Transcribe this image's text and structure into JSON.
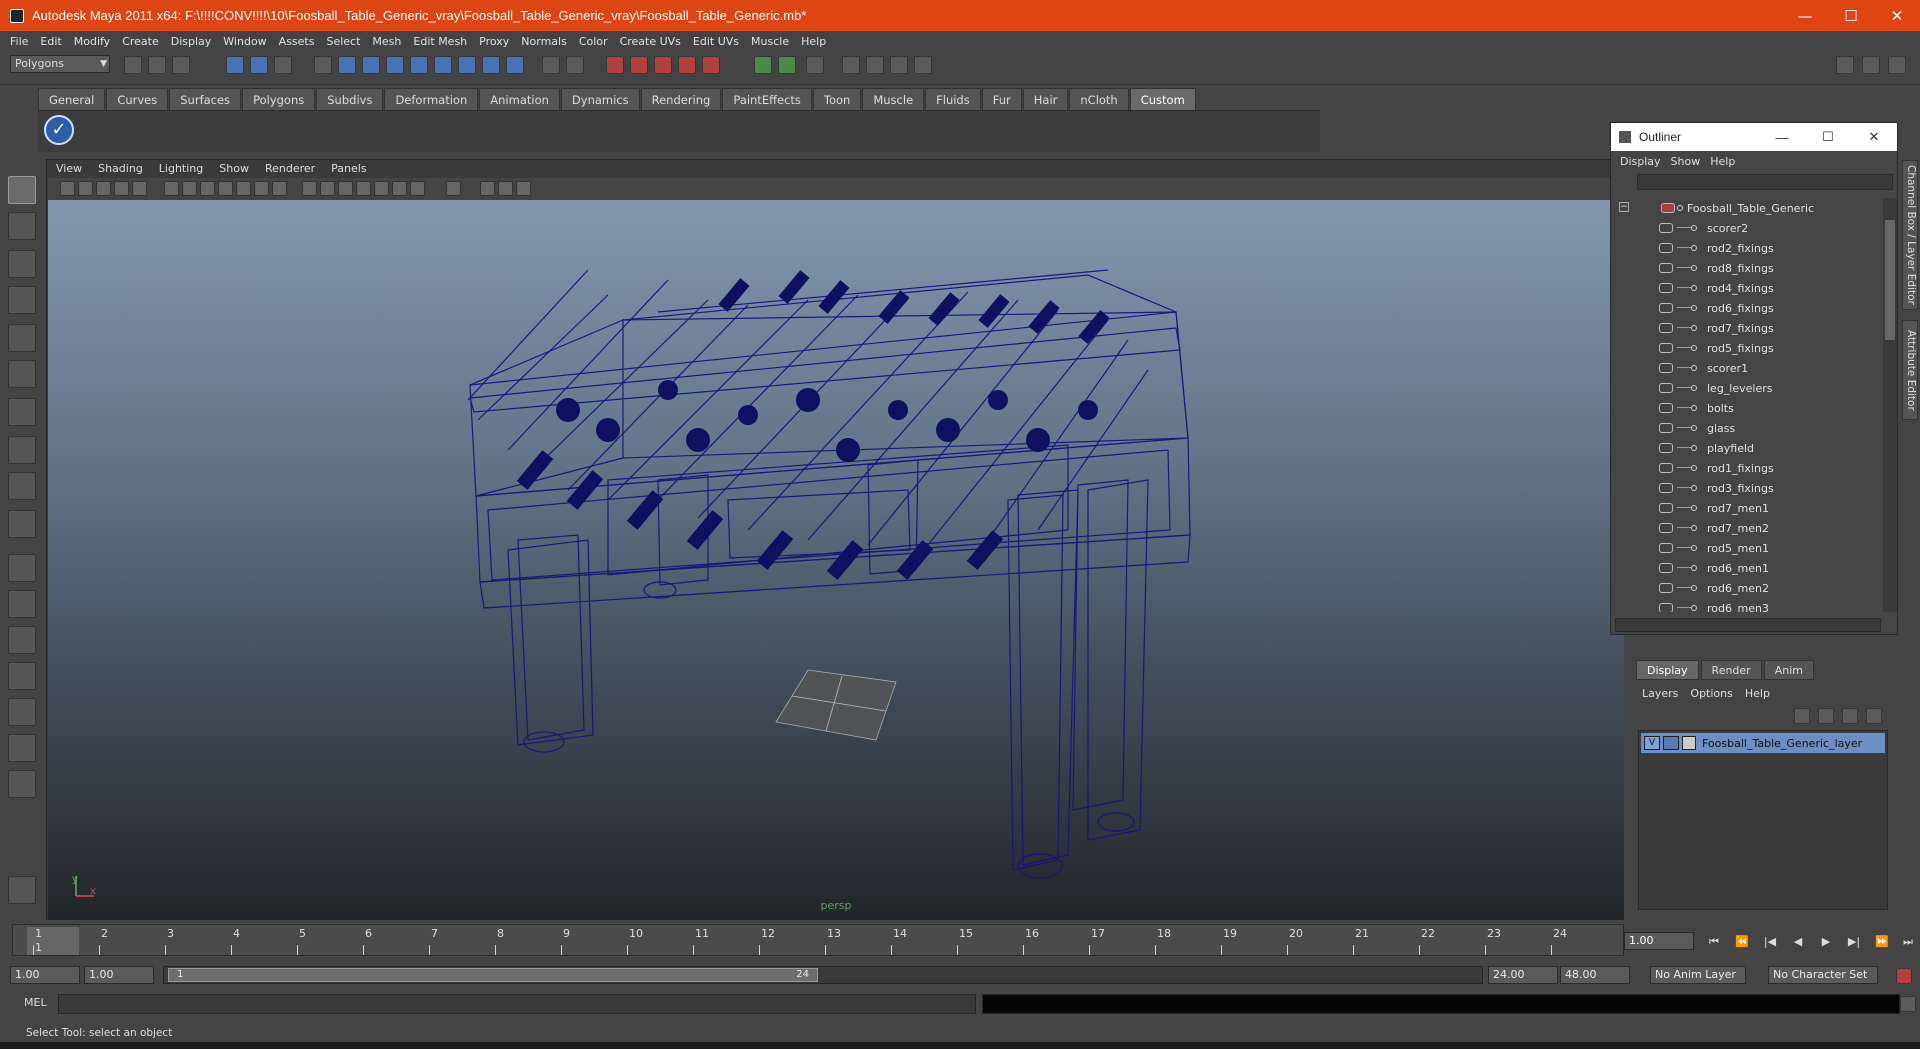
{
  "window": {
    "title": "Autodesk Maya 2011 x64: F:\\!!!!CONV!!!!\\10\\Foosball_Table_Generic_vray\\Foosball_Table_Generic_vray\\Foosball_Table_Generic.mb*",
    "minimize": "—",
    "maximize": "☐",
    "close": "✕"
  },
  "menubar": [
    "File",
    "Edit",
    "Modify",
    "Create",
    "Display",
    "Window",
    "Assets",
    "Select",
    "Mesh",
    "Edit Mesh",
    "Proxy",
    "Normals",
    "Color",
    "Create UVs",
    "Edit UVs",
    "Muscle",
    "Help"
  ],
  "status_line": {
    "mode": "Polygons"
  },
  "shelf": {
    "tabs": [
      "General",
      "Curves",
      "Surfaces",
      "Polygons",
      "Subdivs",
      "Deformation",
      "Animation",
      "Dynamics",
      "Rendering",
      "PaintEffects",
      "Toon",
      "Muscle",
      "Fluids",
      "Fur",
      "Hair",
      "nCloth",
      "Custom"
    ],
    "active_tab": "Custom"
  },
  "panel": {
    "menu": [
      "View",
      "Shading",
      "Lighting",
      "Show",
      "Renderer",
      "Panels"
    ],
    "camera": "persp"
  },
  "outliner": {
    "title": "Outliner",
    "menu": [
      "Display",
      "Show",
      "Help"
    ],
    "root": "Foosball_Table_Generic",
    "items": [
      "scorer2",
      "rod2_fixings",
      "rod8_fixings",
      "rod4_fixings",
      "rod6_fixings",
      "rod7_fixings",
      "rod5_fixings",
      "scorer1",
      "leg_levelers",
      "bolts",
      "glass",
      "playfield",
      "rod1_fixings",
      "rod3_fixings",
      "rod7_men1",
      "rod7_men2",
      "rod5_men1",
      "rod6_men1",
      "rod6_men2",
      "rod6_men3"
    ]
  },
  "side_tabs": {
    "channel_box": "Channel Box / Layer Editor",
    "attribute_editor": "Attribute Editor"
  },
  "layer_editor": {
    "tabs": [
      "Display",
      "Render",
      "Anim"
    ],
    "active_tab": "Display",
    "menu": [
      "Layers",
      "Options",
      "Help"
    ],
    "layers": [
      {
        "visible": "V",
        "name": "Foosball_Table_Generic_layer"
      }
    ]
  },
  "time_slider": {
    "ticks": [
      "1",
      "2",
      "3",
      "4",
      "5",
      "6",
      "7",
      "8",
      "9",
      "10",
      "11",
      "12",
      "13",
      "14",
      "15",
      "16",
      "17",
      "18",
      "19",
      "20",
      "21",
      "22",
      "23",
      "24"
    ],
    "current_frame": "1",
    "current_time_field": "1.00"
  },
  "range_slider": {
    "start_time": "1.00",
    "playback_start": "1.00",
    "range_start": "1",
    "range_end": "24",
    "playback_end": "24.00",
    "end_time": "48.00",
    "anim_layer": "No Anim Layer",
    "character_set": "No Character Set"
  },
  "playback_buttons": [
    "⏮",
    "⏪",
    "|◀",
    "◀",
    "▶",
    "▶|",
    "⏩",
    "⏭"
  ],
  "command_line": {
    "label": "MEL",
    "input": "",
    "output": ""
  },
  "help_line": "Select Tool: select an object",
  "colors": {
    "titlebar": "#de4514",
    "wireframe": "#1a1a7a",
    "layer_highlight": "#6b8fc4"
  }
}
